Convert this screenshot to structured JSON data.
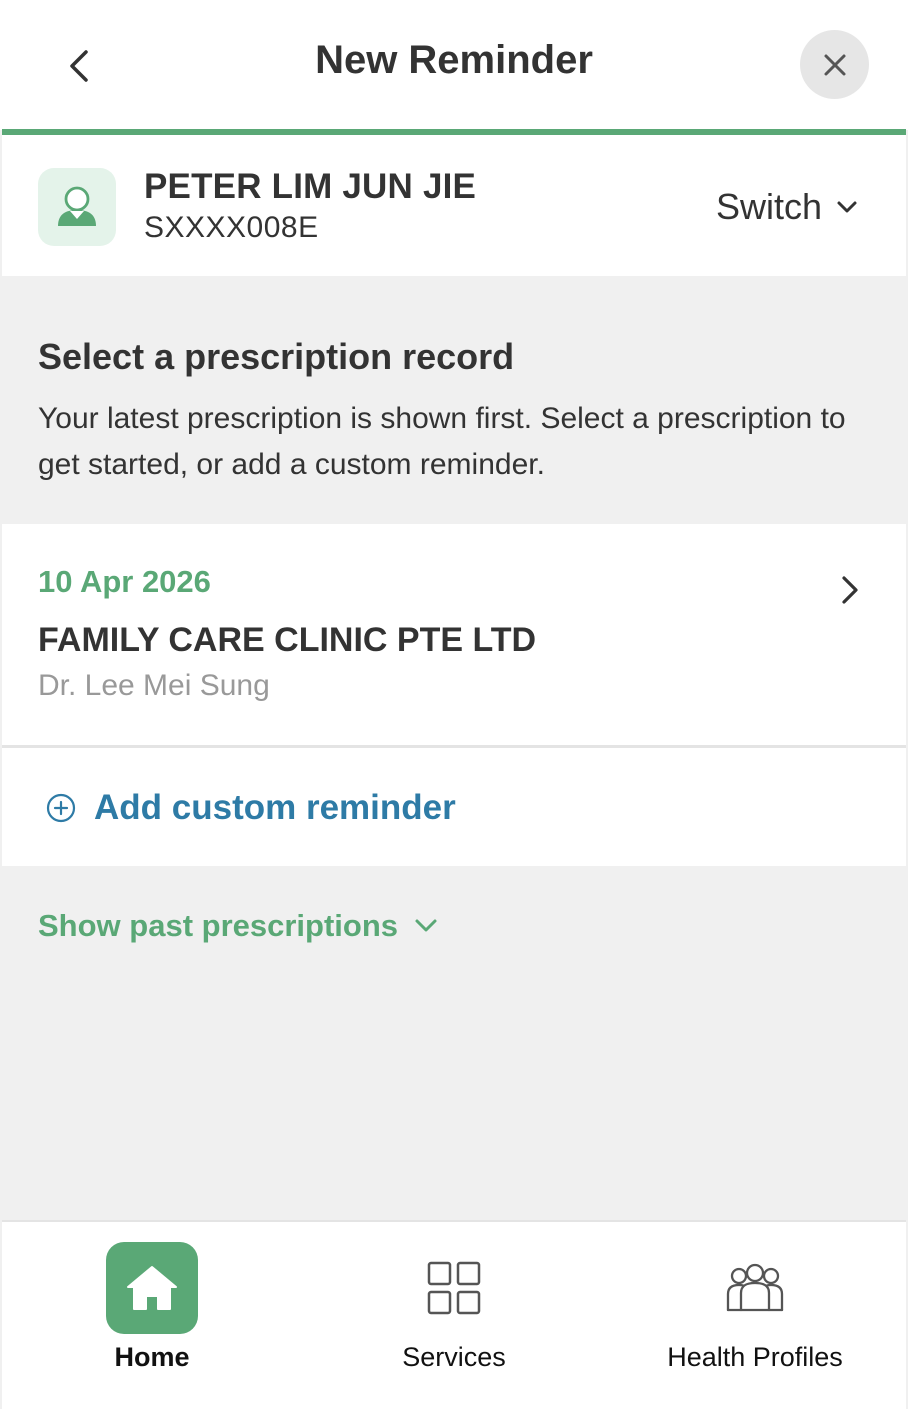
{
  "header": {
    "title": "New Reminder",
    "back_icon": "chevron-left-icon",
    "close_icon": "close-icon"
  },
  "profile": {
    "name": "PETER LIM JUN JIE",
    "id": "SXXXX008E",
    "switch_label": "Switch"
  },
  "section": {
    "title": "Select a prescription record",
    "description": "Your latest prescription is shown first. Select a prescription to get started, or add a custom reminder."
  },
  "prescription": {
    "date": "10 Apr 2026",
    "clinic": "FAMILY CARE CLINIC PTE LTD",
    "doctor": "Dr. Lee Mei Sung"
  },
  "custom_reminder": {
    "label": "Add custom reminder"
  },
  "past": {
    "label": "Show past prescriptions"
  },
  "nav": {
    "items": [
      {
        "label": "Home",
        "icon": "home-icon",
        "active": true
      },
      {
        "label": "Services",
        "icon": "grid-icon",
        "active": false
      },
      {
        "label": "Health Profiles",
        "icon": "people-icon",
        "active": false
      }
    ]
  },
  "colors": {
    "accent_green": "#5aa876",
    "link_blue": "#2e7ba6",
    "background": "#f0f0f0",
    "avatar_bg": "#e4f3ea"
  }
}
